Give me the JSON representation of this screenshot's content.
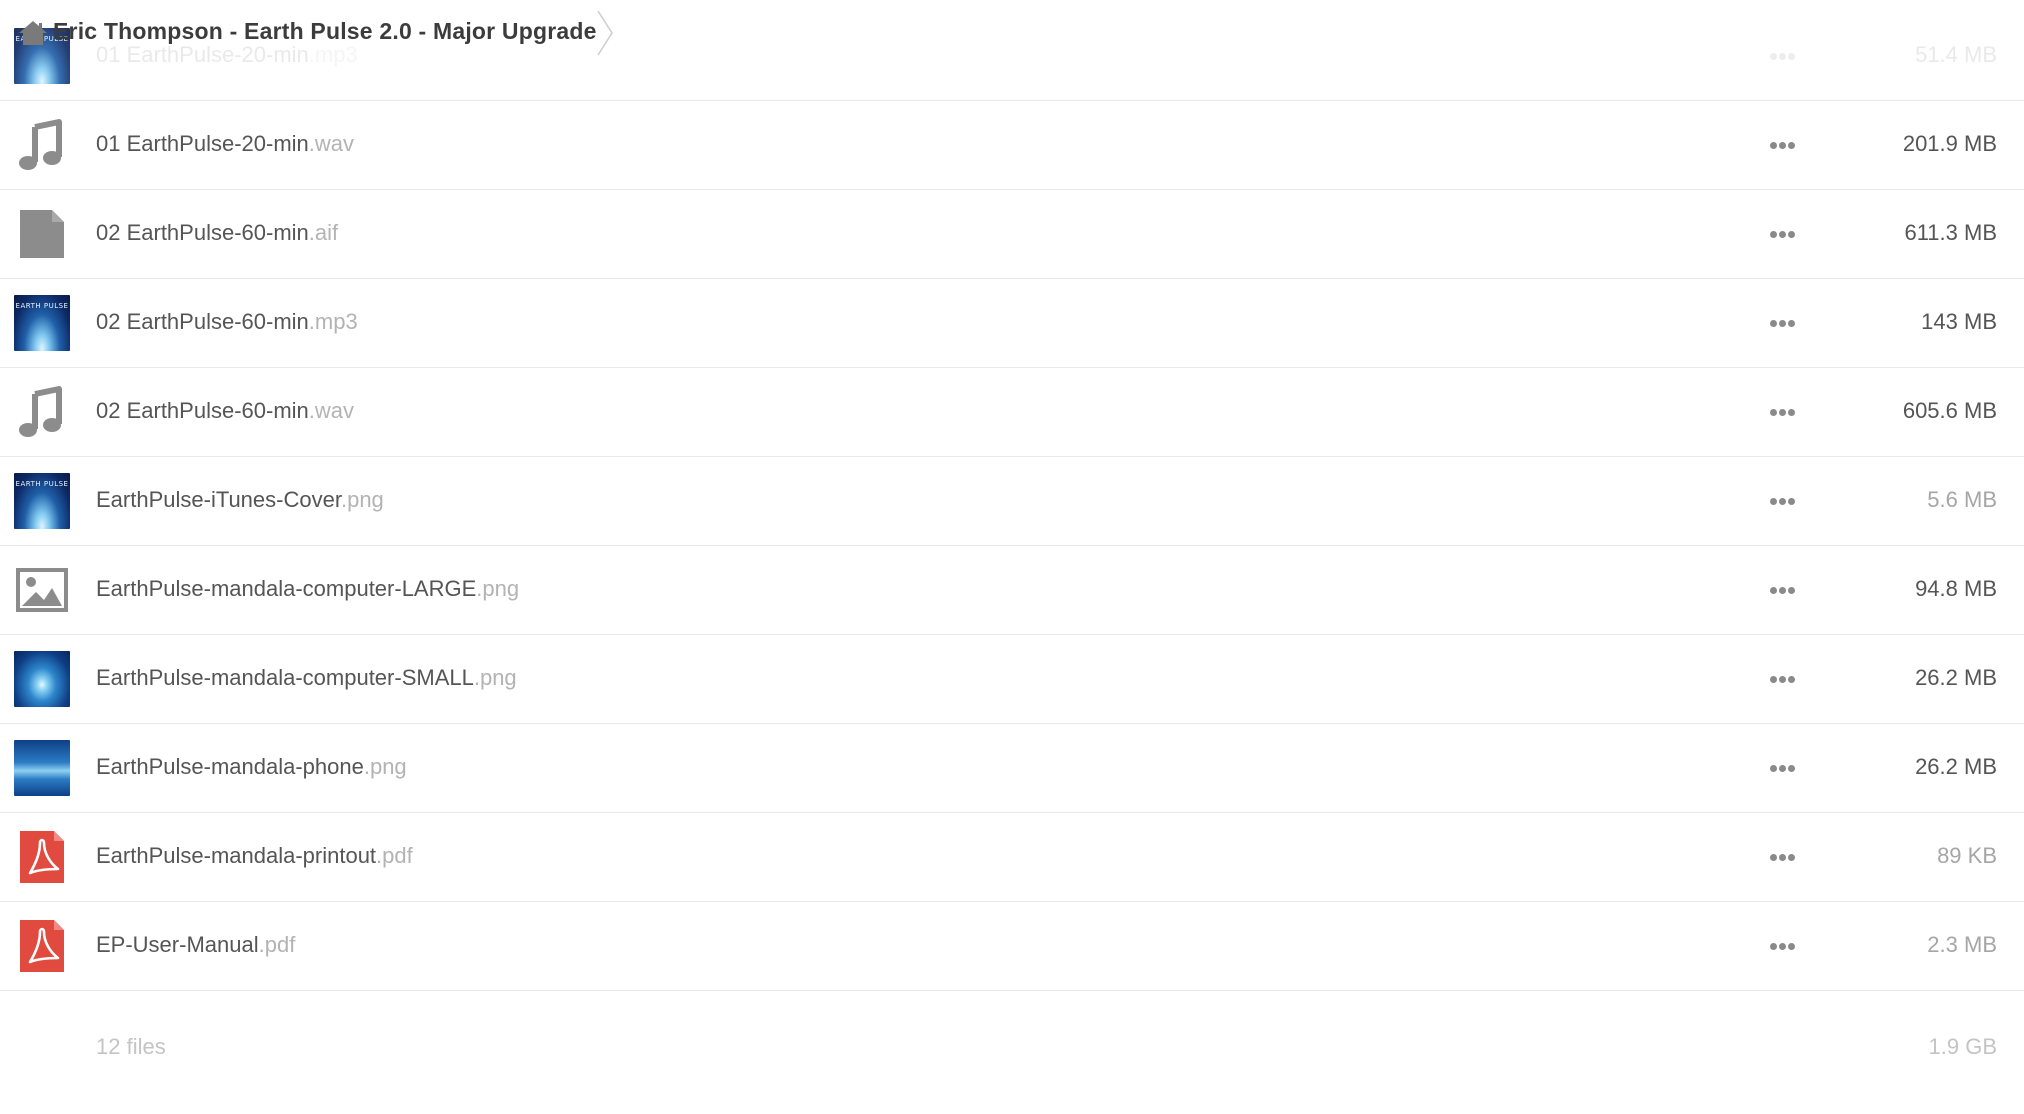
{
  "breadcrumb": {
    "home_icon": "home-icon",
    "title": "Eric Thompson - Earth Pulse 2.0 - Major Upgrade",
    "separator_icon": "chevron-right-icon"
  },
  "files": [
    {
      "base": "01 EarthPulse-20-min",
      "ext": ".mp3",
      "size": "51.4 MB",
      "icon": "album-cover-thumbnail",
      "faded": true
    },
    {
      "base": "01 EarthPulse-20-min",
      "ext": ".wav",
      "size": "201.9 MB",
      "icon": "music-note-icon"
    },
    {
      "base": "02 EarthPulse-60-min",
      "ext": ".aif",
      "size": "611.3 MB",
      "icon": "generic-file-icon"
    },
    {
      "base": "02 EarthPulse-60-min",
      "ext": ".mp3",
      "size": "143 MB",
      "icon": "album-cover-thumbnail"
    },
    {
      "base": "02 EarthPulse-60-min",
      "ext": ".wav",
      "size": "605.6 MB",
      "icon": "music-note-icon"
    },
    {
      "base": "EarthPulse-iTunes-Cover",
      "ext": ".png",
      "size": "5.6 MB",
      "icon": "album-cover-thumbnail"
    },
    {
      "base": "EarthPulse-mandala-computer-LARGE",
      "ext": ".png",
      "size": "94.8 MB",
      "icon": "image-icon"
    },
    {
      "base": "EarthPulse-mandala-computer-SMALL",
      "ext": ".png",
      "size": "26.2 MB",
      "icon": "mandala-wide-thumbnail"
    },
    {
      "base": "EarthPulse-mandala-phone",
      "ext": ".png",
      "size": "26.2 MB",
      "icon": "mandala-phone-thumbnail"
    },
    {
      "base": "EarthPulse-mandala-printout",
      "ext": ".pdf",
      "size": "89 KB",
      "icon": "pdf-icon"
    },
    {
      "base": "EP-User-Manual",
      "ext": ".pdf",
      "size": "2.3 MB",
      "icon": "pdf-icon"
    }
  ],
  "cover_text": "EARTH PULSE",
  "footer": {
    "count": "12 files",
    "total": "1.9 GB"
  },
  "colors": {
    "pdf_red": "#e04a3f",
    "icon_gray": "#8c8c8c",
    "text": "#555555",
    "extension": "#b3b3b3"
  }
}
